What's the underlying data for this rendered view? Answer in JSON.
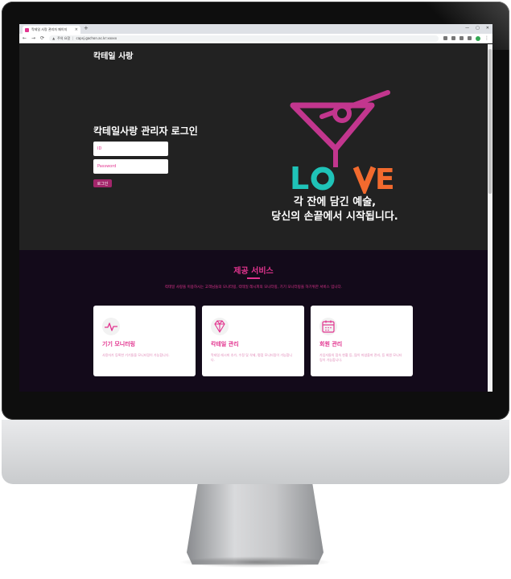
{
  "browser": {
    "tab_title": "칵테일 사랑 관리자 페이지",
    "tab_close": "×",
    "new_tab": "+",
    "window_controls": [
      "—",
      "▢",
      "✕"
    ],
    "url_warning": "주의 요함",
    "url": "capsj.gachon.ac.kr:xxxxx"
  },
  "header": {
    "brand": "칵테일 사랑"
  },
  "login": {
    "title": "칵테일사랑 관리자 로그인",
    "id_placeholder": "ID",
    "password_placeholder": "Password",
    "button_label": "로그인"
  },
  "hero": {
    "logo_text": "LOVE",
    "slogan_line1": "각 잔에 담긴 예술,",
    "slogan_line2": "당신의 손끝에서 시작됩니다."
  },
  "services": {
    "title": "제공 서비스",
    "description": "칵테일 사랑을 이용하시는 고객님들의 모니터링, 칵테일 레시피의 모니터링, 기기 모니터링을 하기위한 서비스 입니다.",
    "cards": [
      {
        "icon": "pulse-icon",
        "title": "기기 모니터링",
        "text": "사용자가 등록한 기기들을 모니터링이 가능합니다."
      },
      {
        "icon": "diamond-icon",
        "title": "칵테일 관리",
        "text": "칵테일 레시피 추가, 수정 및 삭제, 평점 모니터링이 가능합니다."
      },
      {
        "icon": "calendar-icon",
        "title": "회원 관리",
        "text": "가입자들의 접속 현황 등, 많이 마셨을까 관리, 등 회원 모니터링이 가능합니다."
      }
    ]
  },
  "colors": {
    "accent": "#e2348f",
    "button": "#a3266b",
    "hero_bg": "#222222",
    "services_bg": "#130a1a",
    "logo_magenta": "#c2368e",
    "logo_teal": "#1fc3b8",
    "logo_orange": "#f26a2e"
  }
}
